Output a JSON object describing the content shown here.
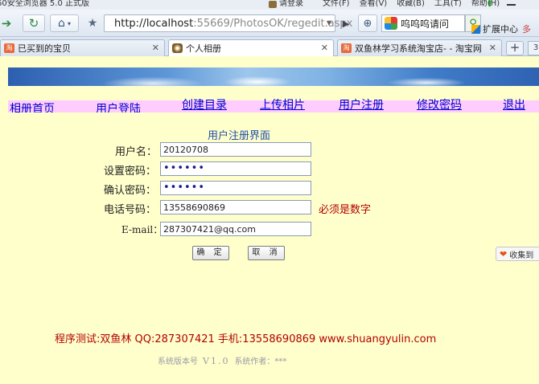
{
  "browser": {
    "app_title": "60安全浏览器 5.0 正式版",
    "login_label": "请登录",
    "menus": [
      "文件(F)",
      "查看(V)",
      "收藏(B)",
      "工具(T)",
      "帮助(H)"
    ],
    "address_host": "http://localhost",
    "address_path": ":55669/PhotosOK/regedit.aspx",
    "search_text": "呜呜呜请问",
    "extension_label": "扩展中心",
    "extension_more": "多"
  },
  "tabs": [
    {
      "label": "已买到的宝贝",
      "icon": "taobao-icon"
    },
    {
      "label": "个人相册",
      "icon": "site-icon"
    },
    {
      "label": "双鱼林学习系统淘宝店- - 淘宝网",
      "icon": "taobao-icon"
    }
  ],
  "tab_counter": "3",
  "site_nav": [
    {
      "label": "相册首页"
    },
    {
      "label": "用户登陆"
    },
    {
      "label": "创建目录"
    },
    {
      "label": "上传相片"
    },
    {
      "label": "用户注册"
    },
    {
      "label": "修改密码"
    },
    {
      "label": "退出"
    }
  ],
  "form": {
    "title": "用户注册界面",
    "username_label": "用户名：",
    "username_value": "20120708",
    "password_label": "设置密码：",
    "password_value": "••••••",
    "confirm_label": "确认密码：",
    "confirm_value": "••••••",
    "phone_label": "电话号码：",
    "phone_value": "13558690869",
    "phone_hint": "必须是数字",
    "email_label": "E-mail：",
    "email_value": "287307421@qq.com",
    "ok_label": "确 定",
    "cancel_label": "取 消"
  },
  "favorite_button": "收集到",
  "footer": {
    "credits": "程序测试:双鱼林 QQ:287307421 手机:13558690869 www.shuangyulin.com",
    "version_label": "系统版本号",
    "version_value": "V1.0",
    "author_label": "系统作者：***"
  }
}
